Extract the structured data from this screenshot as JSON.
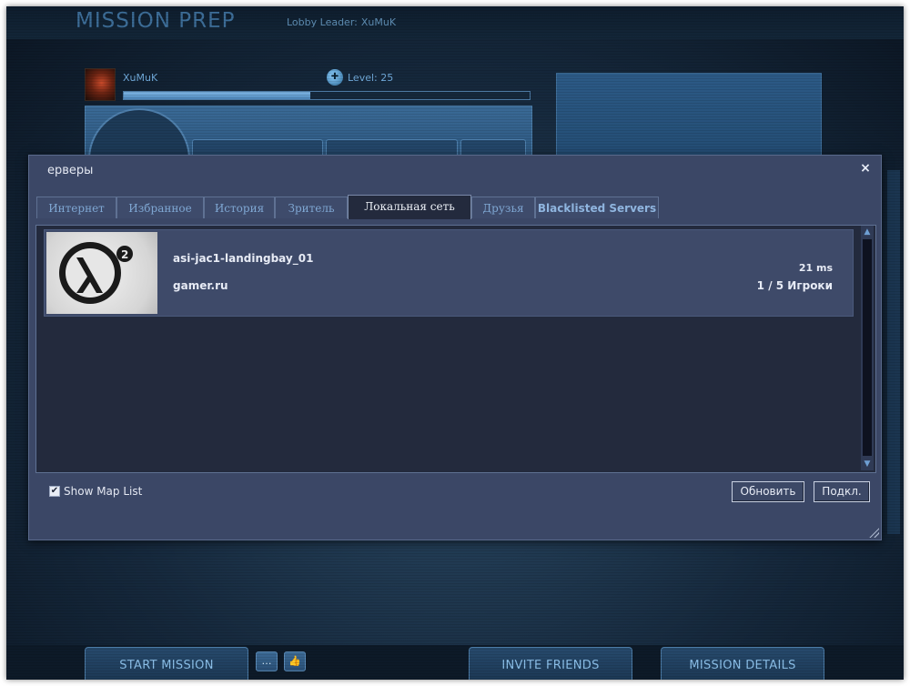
{
  "lobby": {
    "title": "MISSION PREP",
    "leader_label": "Lobby Leader:",
    "leader_name": "XuMuK",
    "player_name": "XuMuK",
    "level_text": "Level: 25",
    "xp_progress": 0.46
  },
  "bottom_bar": {
    "start_mission": "START MISSION",
    "invite_friends": "INVITE FRIENDS",
    "mission_details": "MISSION DETAILS",
    "chat_icon": "chat-bubble-icon",
    "like_icon": "thumbs-up-icon"
  },
  "dialog": {
    "title": "ерверы",
    "close_glyph": "×",
    "tabs": [
      {
        "label": "Интернет",
        "active": false
      },
      {
        "label": "Избранное",
        "active": false
      },
      {
        "label": "История",
        "active": false
      },
      {
        "label": "Зритель",
        "active": false
      },
      {
        "label": "Локальная сеть",
        "active": true
      },
      {
        "label": "Друзья",
        "active": false
      },
      {
        "label": "Blacklisted Servers",
        "active": false
      }
    ],
    "servers": [
      {
        "map": "asi-jac1-landingbay_01",
        "host": "gamer.ru",
        "ping": "21 ms",
        "players": "1 / 5 Игроки",
        "thumbnail_icon": "half-life-2-logo-icon"
      }
    ],
    "show_map_list_label": "Show Map List",
    "show_map_list_checked": true,
    "refresh_button": "Обновить",
    "connect_button": "Подкл."
  },
  "colors": {
    "accent_blue": "#6fa8d8",
    "dialog_bg": "#3b4766",
    "list_bg": "#232a3d"
  }
}
